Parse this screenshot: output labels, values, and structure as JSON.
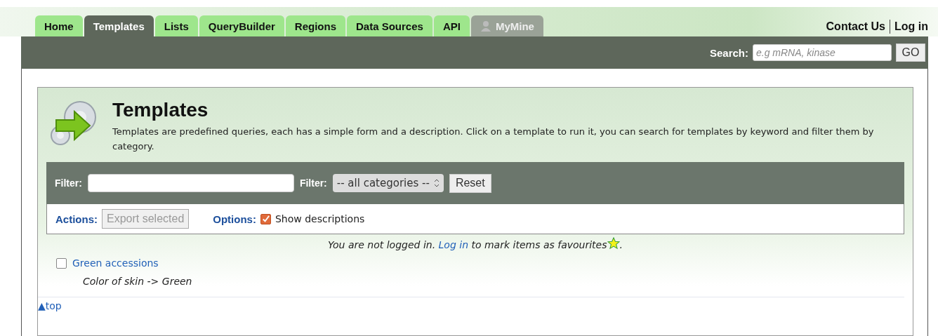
{
  "tabs": [
    {
      "label": "Home",
      "selected": false,
      "kind": "plain"
    },
    {
      "label": "Templates",
      "selected": true,
      "kind": "plain"
    },
    {
      "label": "Lists",
      "selected": false,
      "kind": "plain"
    },
    {
      "label": "QueryBuilder",
      "selected": false,
      "kind": "plain"
    },
    {
      "label": "Regions",
      "selected": false,
      "kind": "plain"
    },
    {
      "label": "Data Sources",
      "selected": false,
      "kind": "plain"
    },
    {
      "label": "API",
      "selected": false,
      "kind": "plain"
    },
    {
      "label": "MyMine",
      "selected": false,
      "kind": "user"
    }
  ],
  "top_links": [
    "Contact Us",
    "Log in"
  ],
  "search": {
    "label": "Search:",
    "placeholder": "e.g mRNA, kinase",
    "button": "GO"
  },
  "panel": {
    "title": "Templates",
    "description": "Templates are predefined queries, each has a simple form and a description. Click on a template to run it, you can search for templates by keyword and filter them by category.",
    "filter_label": "Filter:",
    "category_label": "Filter:",
    "category_value": "-- all categories --",
    "reset": "Reset",
    "actions_label": "Actions:",
    "export_button": {
      "label": "Export selected",
      "disabled": true
    },
    "options_label": "Options:",
    "show_descriptions": {
      "label": "Show descriptions",
      "checked": true
    },
    "login_notice": {
      "before": "You are not logged in.",
      "link": "Log in",
      "after": "to mark items as favourites",
      "end": "."
    },
    "templates": [
      {
        "name": "Green accessions",
        "checked": false,
        "description": "Color of skin -> Green"
      }
    ],
    "top_link": "▲top"
  }
}
